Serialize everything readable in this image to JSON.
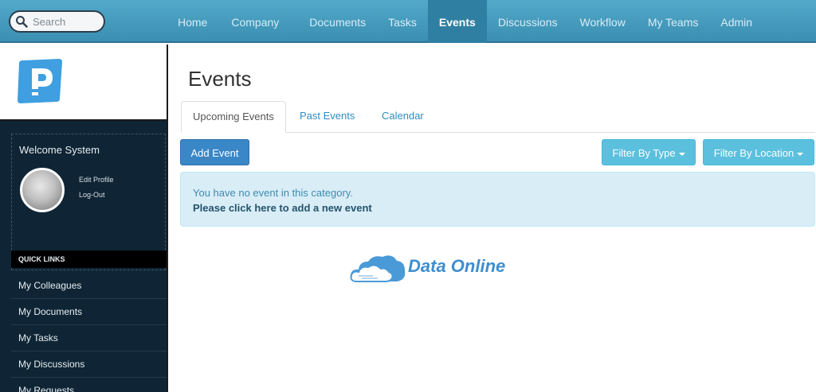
{
  "search": {
    "placeholder": "Search"
  },
  "nav": {
    "items": [
      {
        "label": "Home"
      },
      {
        "label": "Company"
      },
      {
        "label": "Documents"
      },
      {
        "label": "Tasks"
      },
      {
        "label": "Events",
        "active": true
      },
      {
        "label": "Discussions"
      },
      {
        "label": "Workflow"
      },
      {
        "label": "My Teams"
      },
      {
        "label": "Admin"
      }
    ]
  },
  "sidebar": {
    "logo_icon": "p-logo-icon",
    "welcome": "Welcome System",
    "edit_profile": "Edit Profile",
    "logout": "Log-Out",
    "quick_links_title": "QUICK LINKS",
    "quick_links": [
      {
        "label": "My Colleagues"
      },
      {
        "label": "My Documents"
      },
      {
        "label": "My Tasks"
      },
      {
        "label": "My Discussions"
      },
      {
        "label": "My Requests"
      }
    ]
  },
  "main": {
    "title": "Events",
    "tabs": [
      {
        "label": "Upcoming Events",
        "active": true
      },
      {
        "label": "Past Events"
      },
      {
        "label": "Calendar"
      }
    ],
    "add_event": "Add Event",
    "filter_type": "Filter By Type",
    "filter_location": "Filter By Location",
    "alert_message": "You have no event in this category.",
    "alert_link": "Please click here to add a new event"
  },
  "watermark": {
    "text": "Data Online"
  },
  "colors": {
    "topbar": "#4a9fc2",
    "sidebar": "#0f2535",
    "primary": "#3a87c7",
    "info": "#5bc0de",
    "alert_bg": "#d9edf7"
  }
}
